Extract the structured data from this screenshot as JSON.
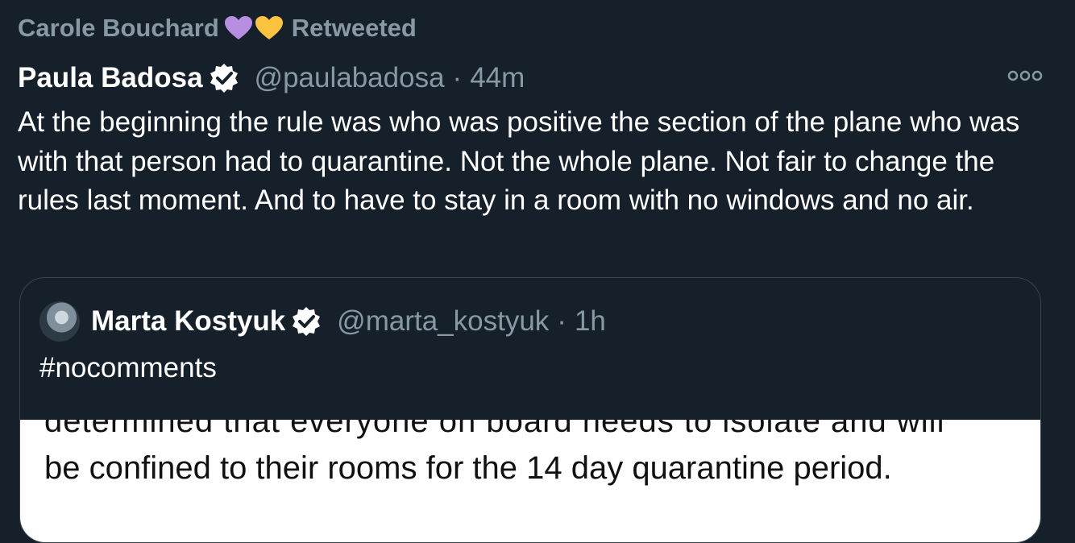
{
  "retweet": {
    "user": "Carole Bouchard",
    "label": "Retweeted",
    "hearts": [
      "purple-heart",
      "yellow-heart"
    ]
  },
  "tweet": {
    "author_name": "Paula Badosa",
    "handle": "@paulabadosa",
    "time": "44m",
    "separator": "·",
    "verified": true,
    "text": "At the beginning the rule was who was positive the section of the plane who was with that person had to quarantine. Not the whole plane. Not fair to change the rules last moment. And to have to stay in a room with no windows and no air."
  },
  "quote": {
    "author_name": "Marta Kostyuk",
    "handle": "@marta_kostyuk",
    "time": "1h",
    "separator": "·",
    "verified": true,
    "text": "#nocomments",
    "image_text_cut": "determined that everyone on board needs to isolate and will",
    "image_text": "be confined to their rooms for the 14 day quarantine period."
  },
  "colors": {
    "background": "#15202b",
    "muted": "#8899a6",
    "border": "#38444d",
    "purple_heart": "#b88fe0",
    "yellow_heart": "#fcc43e"
  }
}
